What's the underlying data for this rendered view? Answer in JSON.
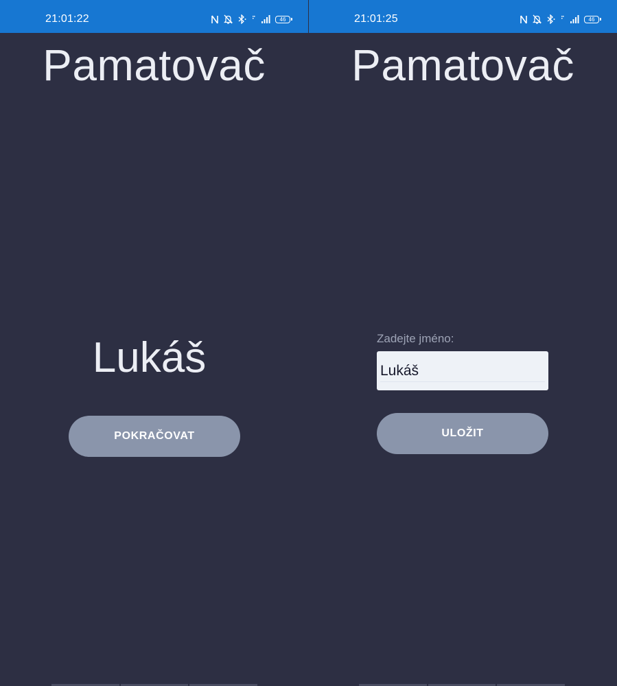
{
  "left_screen": {
    "status_bar": {
      "time": "21:01:22",
      "battery": "46",
      "icons": [
        "nfc-icon",
        "bell-off-icon",
        "bluetooth-icon",
        "wifi-signal-icon",
        "cell-signal-icon",
        "battery-icon"
      ]
    },
    "title": "Pamatovač",
    "name": "Lukáš",
    "continue_button": "POKRAČOVAT"
  },
  "right_screen": {
    "status_bar": {
      "time": "21:01:25",
      "battery": "46",
      "icons": [
        "nfc-icon",
        "bell-off-icon",
        "bluetooth-icon",
        "wifi-signal-icon",
        "cell-signal-icon",
        "battery-icon"
      ]
    },
    "title": "Pamatovač",
    "name_label": "Zadejte jméno:",
    "name_value": "Lukáš",
    "save_button": "ULOŽIT"
  },
  "colors": {
    "status_bar": "#1777d2",
    "background": "#2d2f43",
    "button": "#8a95ab",
    "input_bg": "#eef2f7"
  }
}
